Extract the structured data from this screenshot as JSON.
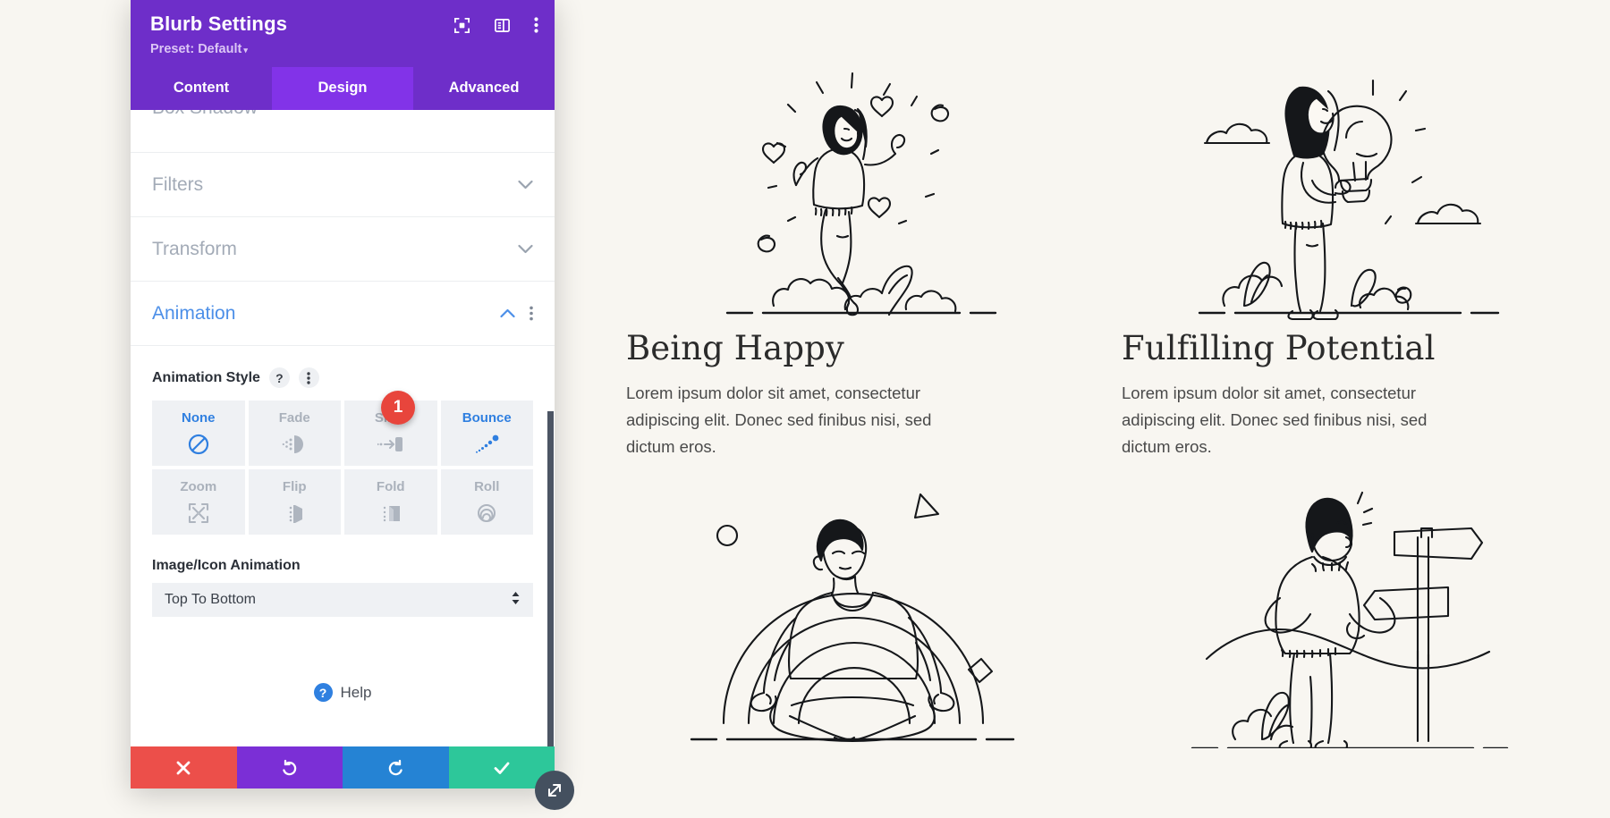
{
  "preview": {
    "blurbs": [
      {
        "art": "woman-jumping-celebration-illustration",
        "title": "Being Happy",
        "body": "Lorem ipsum dolor sit amet, consectetur adipiscing elit. Donec sed finibus nisi, sed dictum eros."
      },
      {
        "art": "woman-holding-lightbulb-illustration",
        "title": "Fulfilling Potential",
        "body": "Lorem ipsum dolor sit amet, consectetur adipiscing elit. Donec sed finibus nisi, sed dictum eros."
      },
      {
        "art": "man-meditating-lotus-illustration",
        "title": "",
        "body": ""
      },
      {
        "art": "man-at-signpost-illustration",
        "title": "",
        "body": ""
      }
    ]
  },
  "modal": {
    "title": "Blurb Settings",
    "preset_label": "Preset: Default",
    "preset_caret": "▾",
    "header_icons": [
      {
        "name": "focus-target-icon"
      },
      {
        "name": "panel-layout-icon"
      },
      {
        "name": "more-options-icon"
      }
    ],
    "tabs": [
      {
        "label": "Content",
        "active": false
      },
      {
        "label": "Design",
        "active": true
      },
      {
        "label": "Advanced",
        "active": false
      }
    ],
    "sections": [
      {
        "label": "Box Shadow",
        "open": false
      },
      {
        "label": "Filters",
        "open": false
      },
      {
        "label": "Transform",
        "open": false
      },
      {
        "label": "Animation",
        "open": true
      }
    ],
    "animation": {
      "style_label": "Animation Style",
      "help_glyph": "?",
      "styles": [
        {
          "label": "None",
          "icon": "ban-icon",
          "state": "selected"
        },
        {
          "label": "Fade",
          "icon": "fade-icon",
          "state": "normal"
        },
        {
          "label": "Slide",
          "icon": "slide-icon",
          "state": "normal"
        },
        {
          "label": "Bounce",
          "icon": "bounce-icon",
          "state": "highlighted"
        },
        {
          "label": "Zoom",
          "icon": "zoom-icon",
          "state": "normal"
        },
        {
          "label": "Flip",
          "icon": "flip-icon",
          "state": "normal"
        },
        {
          "label": "Fold",
          "icon": "fold-icon",
          "state": "normal"
        },
        {
          "label": "Roll",
          "icon": "roll-icon",
          "state": "normal"
        }
      ],
      "badge_number": "1",
      "image_icon_animation_label": "Image/Icon Animation",
      "image_icon_animation_value": "Top To Bottom"
    },
    "help": {
      "glyph": "?",
      "label": "Help"
    },
    "actions": [
      {
        "name": "cancel-button",
        "icon": "close-icon"
      },
      {
        "name": "undo-button",
        "icon": "undo-icon"
      },
      {
        "name": "redo-button",
        "icon": "redo-icon"
      },
      {
        "name": "save-button",
        "icon": "check-icon"
      }
    ],
    "resize_handle": "resize-diagonal-icon"
  },
  "colors": {
    "page_bg": "#f8f6f1",
    "header_purple": "#6e2ec9",
    "tab_active_purple": "#8233e8",
    "accent_blue": "#2f7fe0",
    "badge_red": "#e8453c",
    "cancel_red": "#ec4f4a",
    "undo_purple": "#7b2fd6",
    "redo_blue": "#2583d4",
    "save_green": "#2dc79a"
  }
}
